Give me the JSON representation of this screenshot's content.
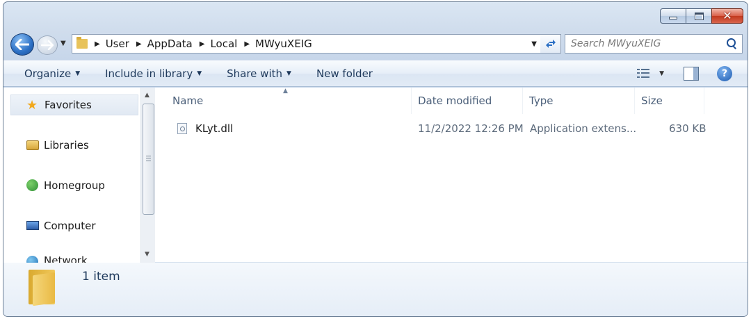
{
  "window": {
    "controls": {
      "minimize": "minimize",
      "maximize": "maximize",
      "close": "✕"
    }
  },
  "nav": {
    "breadcrumbs": [
      "User",
      "AppData",
      "Local",
      "MWyuXEIG"
    ],
    "search_placeholder": "Search MWyuXEIG"
  },
  "toolbar": {
    "organize": "Organize",
    "include": "Include in library",
    "share": "Share with",
    "new_folder": "New folder"
  },
  "sidebar": {
    "items": [
      {
        "label": "Favorites",
        "icon": "star-icon"
      },
      {
        "label": "Libraries",
        "icon": "libraries-icon"
      },
      {
        "label": "Homegroup",
        "icon": "homegroup-icon"
      },
      {
        "label": "Computer",
        "icon": "computer-icon"
      },
      {
        "label": "Network",
        "icon": "network-icon"
      }
    ]
  },
  "table": {
    "columns": [
      "Name",
      "Date modified",
      "Type",
      "Size"
    ],
    "rows": [
      {
        "name": "KLyt.dll",
        "date": "11/2/2022 12:26 PM",
        "type": "Application extens...",
        "size": "630 KB"
      }
    ]
  },
  "details": {
    "count": "1 item"
  },
  "colors": {
    "accent": "#1e395b",
    "chrome": "#cfdcec",
    "selection": "#e1e9f3"
  }
}
